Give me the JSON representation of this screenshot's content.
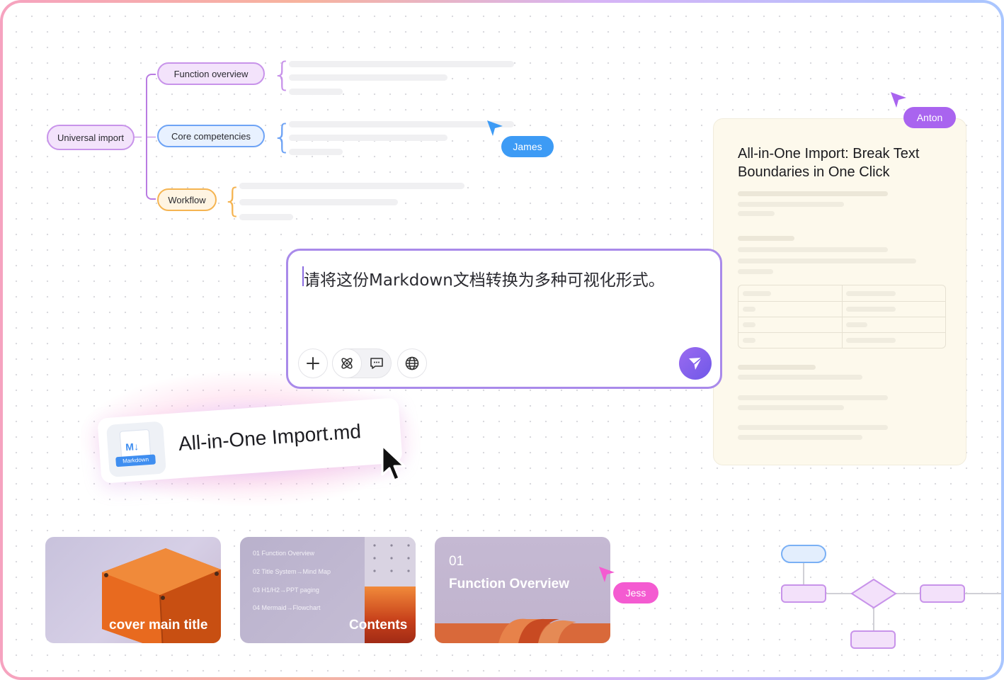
{
  "mindmap": {
    "root": "Universal import",
    "branches": [
      {
        "label": "Function overview"
      },
      {
        "label": "Core competencies"
      },
      {
        "label": "Workflow"
      }
    ]
  },
  "cursors": {
    "james": "James",
    "anton": "Anton",
    "jess": "Jess"
  },
  "document": {
    "title": "All-in-One Import: Break Text Boundaries in One Click"
  },
  "prompt": {
    "text": "请将这份Markdown文档转换为多种可视化形式。"
  },
  "file": {
    "name": "All-in-One Import.md",
    "badge": "Markdown",
    "mark": "M↓"
  },
  "slides": [
    {
      "title": "cover main title"
    },
    {
      "title": "Contents",
      "toc": [
        "01 Function Overview",
        "02 Title System→Mind Map",
        "03 H1/H2→PPT paging",
        "04 Mermaid→Flowchart"
      ]
    },
    {
      "number": "01",
      "title": "Function Overview"
    }
  ],
  "colors": {
    "accent": "#a98aea",
    "james": "#3d9bf5",
    "anton": "#a964ef",
    "jess": "#f45bd1"
  }
}
